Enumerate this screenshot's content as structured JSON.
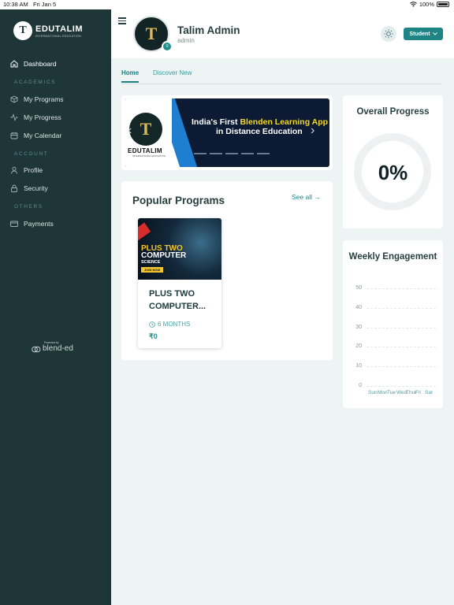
{
  "status_bar": {
    "time": "10:38 AM",
    "date": "Fri Jan 5",
    "battery": "100%"
  },
  "brand": {
    "initial": "T",
    "name": "EDUTALIM",
    "subtitle": "INTERNATIONAL EDUCATION"
  },
  "sidebar": {
    "dashboard": "Dashboard",
    "sections": {
      "academics": "ACADEMICS",
      "account": "ACCOUNT",
      "others": "OTHERS"
    },
    "items": {
      "my_programs": "My Programs",
      "my_progress": "My Progress",
      "my_calendar": "My Calendar",
      "profile": "Profile",
      "security": "Security",
      "payments": "Payments"
    },
    "powered_by": "Powered by",
    "powered_brand": "blend-ed"
  },
  "header": {
    "avatar_initial": "T",
    "user_name": "Talim Admin",
    "user_role": "admin",
    "role_button": "Student"
  },
  "tabs": {
    "home": "Home",
    "discover": "Discover New"
  },
  "banner": {
    "logo_initial": "T",
    "logo_name": "EDUTALIM",
    "logo_sub": "INTERNATIONAL EDUCATION",
    "line1_prefix": "India's First ",
    "line1_highlight": "Blenden Learning App",
    "line2": "in Distance Education",
    "slide_count": 5
  },
  "popular": {
    "title": "Popular Programs",
    "see_all": "See all",
    "programs": [
      {
        "title": "PLUS TWO COMPUTER...",
        "image_line1": "PLUS TWO",
        "image_line2": "COMPUTER",
        "image_line3": "SCIENCE",
        "image_cta": "JOIN NOW",
        "duration": "6 MONTHS",
        "price": "₹0"
      }
    ]
  },
  "progress": {
    "title": "Overall Progress",
    "value": "0%",
    "fraction": 0
  },
  "engagement": {
    "title": "Weekly Engagement"
  },
  "chart_data": {
    "type": "bar",
    "categories": [
      "Sun",
      "Mon",
      "Tue",
      "Wed",
      "Thur",
      "Fri",
      "Sat"
    ],
    "values": [
      0,
      0,
      0,
      0,
      0,
      0,
      0
    ],
    "title": "Weekly Engagement",
    "xlabel": "",
    "ylabel": "",
    "ylim": [
      0,
      50
    ],
    "yticks": [
      "50",
      "40",
      "30",
      "20",
      "10",
      "0"
    ],
    "grid": true
  },
  "colors": {
    "sidebar": "#1f3639",
    "accent": "#1e8486",
    "background": "#eef3f4"
  }
}
